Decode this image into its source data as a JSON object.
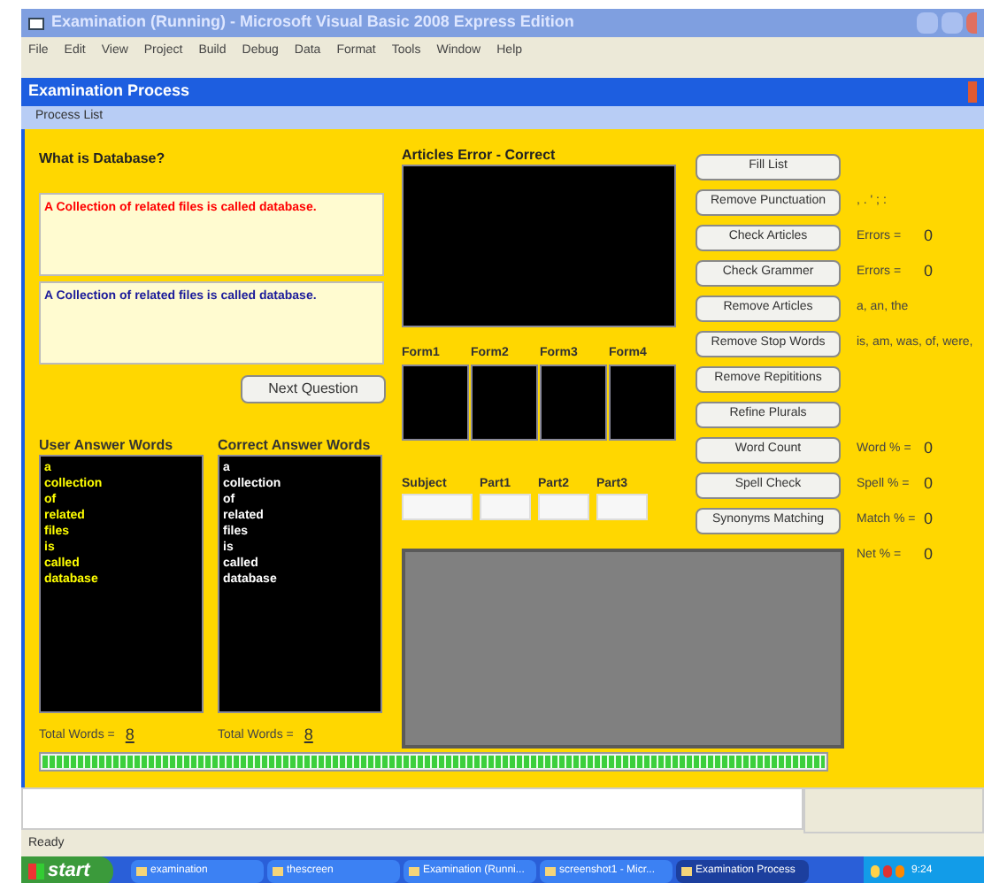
{
  "ide": {
    "title": "Examination (Running) - Microsoft Visual Basic 2008 Express Edition",
    "menu": [
      "File",
      "Edit",
      "View",
      "Project",
      "Build",
      "Debug",
      "Data",
      "Format",
      "Tools",
      "Window",
      "Help"
    ]
  },
  "form": {
    "title": "Examination Process",
    "menu": [
      "Process List"
    ],
    "question": "What is Database?",
    "answer_boxes": [
      {
        "text": "A Collection of related files is called database.",
        "color": "#ff0000"
      },
      {
        "text": "A Collection of related files is called database.",
        "color": "#1a1a9a"
      }
    ],
    "next_button": "Next Question",
    "word_lists": [
      {
        "heading": "User Answer Words",
        "words": [
          "a",
          "collection",
          "of",
          "related",
          "files",
          "is",
          "called",
          "database"
        ],
        "total_label": "Total Words =",
        "total": "8",
        "color": "#ffff00"
      },
      {
        "heading": "Correct Answer Words",
        "words": [
          "a",
          "collection",
          "of",
          "related",
          "files",
          "is",
          "called",
          "database"
        ],
        "total_label": "Total Words =",
        "total": "8",
        "color": "#ffffff"
      }
    ],
    "articles_heading": "Articles Error - Correct",
    "forms": [
      "Form1",
      "Form2",
      "Form3",
      "Form4"
    ],
    "subject_fields": [
      "Subject",
      "Part1",
      "Part2",
      "Part3"
    ],
    "buttons": [
      {
        "label": "Fill List"
      },
      {
        "label": "Remove Punctuation",
        "note": ", . ' ; :"
      },
      {
        "label": "Check Articles",
        "stat": "Errors =",
        "value": "0"
      },
      {
        "label": "Check Grammer",
        "stat": "Errors =",
        "value": "0"
      },
      {
        "label": "Remove Articles",
        "note": "a, an, the"
      },
      {
        "label": "Remove Stop Words",
        "note": "is, am, was, of, were,"
      },
      {
        "label": "Remove Repititions"
      },
      {
        "label": "Refine Plurals"
      },
      {
        "label": "Word Count",
        "stat": "Word % =",
        "value": "0"
      },
      {
        "label": "Spell Check",
        "stat": "Spell % =",
        "value": "0"
      },
      {
        "label": "Synonyms Matching",
        "stat": "Match % =",
        "value": "0"
      }
    ],
    "net": {
      "stat": "Net % =",
      "value": "0"
    },
    "progress": {
      "level": 1
    }
  },
  "status_bar": "Ready",
  "taskbar": {
    "start": "start",
    "items": [
      {
        "label": "examination",
        "selected": false
      },
      {
        "label": "thescreen",
        "selected": false
      },
      {
        "label": "Examination (Runni...",
        "selected": false
      },
      {
        "label": "screenshot1 - Micr...",
        "selected": false
      },
      {
        "label": "Examination Process",
        "selected": true
      }
    ],
    "time": "9:24"
  }
}
